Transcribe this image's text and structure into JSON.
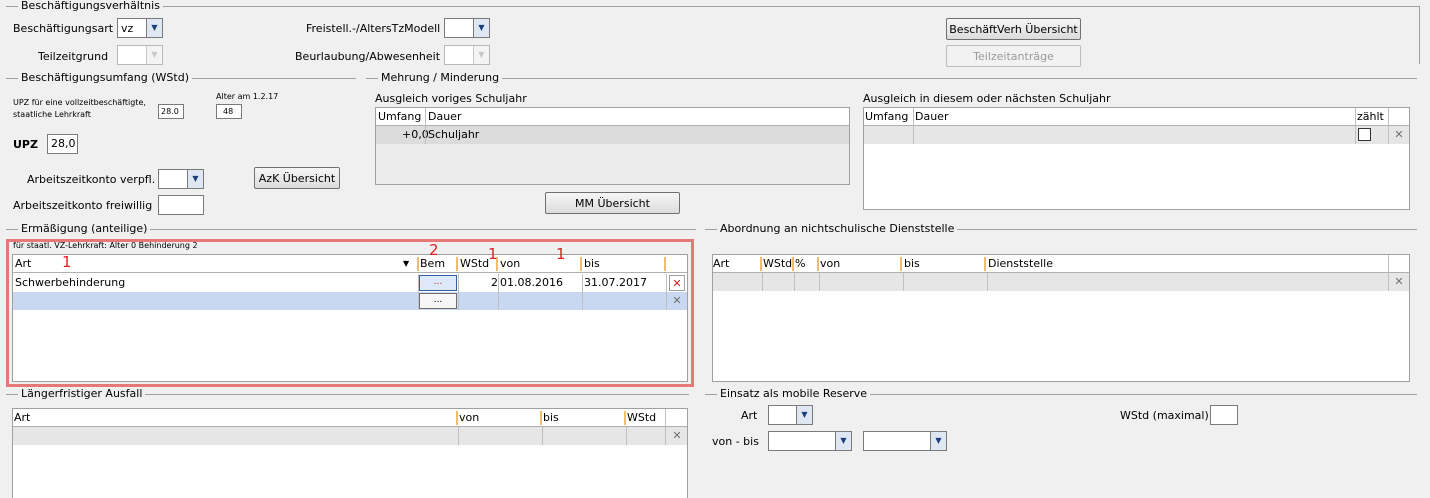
{
  "beschaeftigung": {
    "title": "Beschäftigungsverhältnis",
    "art_label": "Beschäftigungsart",
    "art_value": "vz",
    "teilzeitgrund_label": "Teilzeitgrund",
    "freistell_label": "Freistell.-/AltersTzModell",
    "beurlaubung_label": "Beurlaubung/Abwesenheit",
    "btn_uebersicht": "BeschäftVerh Übersicht",
    "btn_teilzeit": "Teilzeitanträge"
  },
  "umfang": {
    "title": "Beschäftigungsumfang (WStd)",
    "upz_info_line1": "UPZ für eine vollzeitbeschäftigte,",
    "upz_info_line2": "staatliche Lehrkraft",
    "upz_info_value": "28.0",
    "alter_label": "Alter am 1.2.17",
    "alter_value": "48",
    "upz_label": "UPZ",
    "upz_value": "28,0",
    "azk_verpfl_label": "Arbeitszeitkonto verpfl.",
    "azk_frei_label": "Arbeitszeitkonto freiwillig",
    "btn_azk": "AzK Übersicht"
  },
  "mehrung": {
    "title": "Mehrung / Minderung",
    "voriges_label": "Ausgleich voriges Schuljahr",
    "voriges_headers": [
      "Umfang",
      "Dauer"
    ],
    "voriges_row": {
      "umfang": "+0,0",
      "dauer": "Schuljahr"
    },
    "diesem_label": "Ausgleich in diesem oder nächsten Schuljahr",
    "diesem_headers": [
      "Umfang",
      "Dauer",
      "zählt"
    ],
    "btn_mm": "MM Übersicht"
  },
  "ermaessigung": {
    "title": "Ermäßigung (anteilige)",
    "info": "für staatl. VZ-Lehrkraft: Alter 0 Behinderung 2",
    "headers": {
      "art": "Art",
      "bem": "Bem",
      "wstd": "WStd",
      "von": "von",
      "bis": "bis"
    },
    "row": {
      "art": "Schwerbehinderung",
      "bem": "...",
      "wstd": "2",
      "von": "01.08.2016",
      "bis": "31.07.2017"
    },
    "empty_bem": "...",
    "annotations": [
      "1",
      "2",
      "1",
      "1"
    ]
  },
  "abordnung": {
    "title": "Abordnung an nichtschulische Dienststelle",
    "headers": [
      "Art",
      "WStd",
      "%",
      "von",
      "bis",
      "Dienststelle"
    ]
  },
  "ausfall": {
    "title": "Längerfristiger Ausfall",
    "headers": [
      "Art",
      "von",
      "bis",
      "WStd"
    ]
  },
  "reserve": {
    "title": "Einsatz als mobile Reserve",
    "art_label": "Art",
    "wstd_label": "WStd (maximal)",
    "vonbis_label": "von - bis"
  }
}
